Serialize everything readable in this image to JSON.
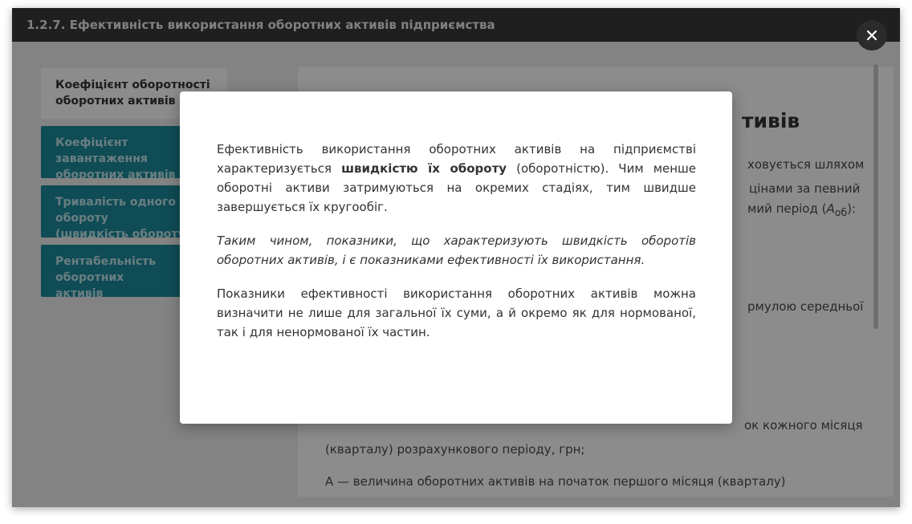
{
  "window": {
    "title": "1.2.7. Ефективність використання оборотних активів підприємства",
    "close_icon": "close-icon"
  },
  "nav": {
    "items": [
      {
        "label": "Коефіцієнт оборотності\nоборотних активів",
        "active": true
      },
      {
        "label": "Коефіцієнт завантаження\nоборотних активів",
        "active": false
      },
      {
        "label": "Тривалість одного обороту\n(швидкість обороту)",
        "active": false
      },
      {
        "label": "Рентабельність оборотних\nактивів",
        "active": false
      }
    ]
  },
  "content": {
    "heading_fragment": "тивів",
    "line1_fragment": "ховується шляхом",
    "line2_fragment": "цінами за певний",
    "line3_fragment": "мий період (",
    "line3_var": "A",
    "line3_sub": "об",
    "line3_end": "):",
    "line4_fragment": "рмулою середньої",
    "line5_fragment": "ок кожного місяця",
    "line6": "(кварталу) розрахункового періоду, грн;",
    "line7": "A    — величина оборотних активів на початок першого місяця (кварталу)"
  },
  "dialog": {
    "p1_start": "Ефективність використання оборотних активів на підприємстві характеризується ",
    "p1_bold": "швидкістю їх обороту",
    "p1_end": " (оборотністю). Чим менше оборотні активи затримуються на окремих стадіях, тим швидше завершується їх кругообіг.",
    "p2": "Таким чином, показники, що характеризують швидкість оборотів оборотних активів, і є показниками ефективності їх використання.",
    "p3": "Показники ефективності використання оборотних активів можна визначити не лише для загальної їх суми, а й окремо як для нормованої, так і для ненормованої їх частин."
  },
  "colors": {
    "nav_accent": "#1d8b9b",
    "titlebar": "#3a3a3a"
  }
}
